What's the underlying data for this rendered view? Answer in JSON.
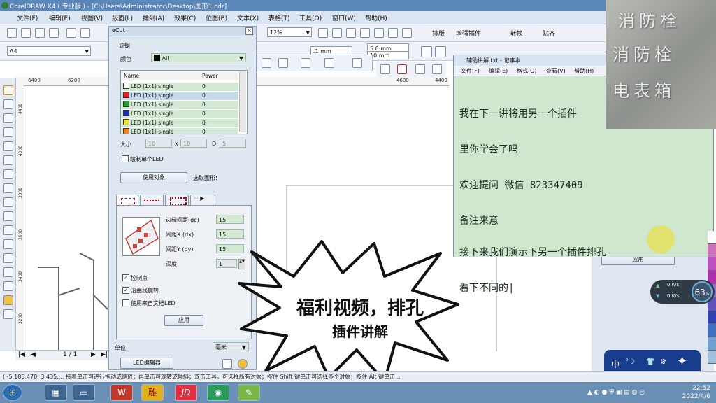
{
  "window": {
    "title": "CorelDRAW X4 ( 专业版 ) - [C:\\Users\\Administrator\\Desktop\\图形1.cdr]"
  },
  "menu": [
    "文件(F)",
    "编辑(E)",
    "视图(V)",
    "版面(L)",
    "排列(A)",
    "效果(C)",
    "位图(B)",
    "文本(X)",
    "表格(T)",
    "工具(O)",
    "窗口(W)",
    "帮助(H)"
  ],
  "toolbar": {
    "zoom": "12%",
    "page_size": "A4",
    "nudge": ".1 mm",
    "dup_x": "5.0 mm",
    "dup_y": "10 mm",
    "plugins": [
      "排版",
      "增强插件",
      "转换",
      "贴齐"
    ]
  },
  "rulers": {
    "h": [
      "6400",
      "6200",
      "4600",
      "4400"
    ],
    "v": [
      "4400",
      "4000",
      "3800",
      "3600",
      "3400",
      "3200"
    ]
  },
  "pagenav": {
    "page": "1 / 1"
  },
  "status": "( -5,185.478, 3,435.... 接着单击可进行拖动或缩放；再单击可旋转或倾斜；双击工具，可选择所有对象；按住 Shift 键单击可选择多个对象；按住 Alt 键单击...",
  "ecut": {
    "title": "eCut",
    "section": "滤镜",
    "color_label": "颜色",
    "color_value": "All",
    "table": {
      "headers": [
        "Name",
        "Power"
      ],
      "rows": [
        {
          "name": "LED (1x1) single",
          "power": "0",
          "color": "#ffffff"
        },
        {
          "name": "LED (1x1) single",
          "power": "0",
          "color": "#e02020"
        },
        {
          "name": "LED (1x1) single",
          "power": "0",
          "color": "#20a020"
        },
        {
          "name": "LED (1x1) single",
          "power": "0",
          "color": "#2030c0"
        },
        {
          "name": "LED (1x1) single",
          "power": "0",
          "color": "#e8e020"
        },
        {
          "name": "LED (1x1) single",
          "power": "0",
          "color": "#f08020"
        }
      ]
    },
    "size_label": "大小",
    "size_w": "10",
    "size_x": "x",
    "size_h": "10",
    "size_d_label": "D",
    "size_d": "5",
    "draw_single": "绘制单个LED",
    "use_object": "使用对象",
    "select_hint": "选取图形!",
    "margin_label": "边缘间距(dc)",
    "margin": "15",
    "gapx_label": "间距X (dx)",
    "gapx": "15",
    "gapy_label": "间距Y (dy)",
    "gapy": "15",
    "depth_label": "深度",
    "depth": "1",
    "ctrl_points": "控制点",
    "rotate_curve": "沿曲线旋转",
    "use_doc_led": "使用来自文档LED",
    "apply": "应用",
    "unit_label": "单位",
    "unit": "毫米",
    "led_editor": "LED编辑器"
  },
  "notepad": {
    "title": "辅助讲解.txt - 记事本",
    "menu": [
      "文件(F)",
      "编辑(E)",
      "格式(O)",
      "查看(V)",
      "帮助(H)"
    ],
    "lines_top": [
      "我在下一讲将用另一个插件",
      "里你学会了吗",
      "欢迎提问 微信 823347409",
      "备注来意"
    ],
    "lines_bottom": [
      "接下来我们演示下另一个插件排孔",
      "看下不同的|"
    ]
  },
  "right_panel": {
    "apply": "应用"
  },
  "photo_text": [
    "消防栓",
    "消防栓",
    "电表箱"
  ],
  "speed": {
    "up": "0",
    "up_unit": "K/s",
    "down": "0",
    "down_unit": "K/s",
    "percent": "63"
  },
  "ime": {
    "lang": "中"
  },
  "burst": {
    "line1": "福利视频，排孔",
    "line2": "插件讲解"
  },
  "taskbar": {
    "time": "22:52",
    "date": "2022/4/6"
  },
  "colors": {
    "panel": "#dfe7f1",
    "notepad_bg": "#cfe6cf",
    "taskbar": "#6a8fb4"
  }
}
